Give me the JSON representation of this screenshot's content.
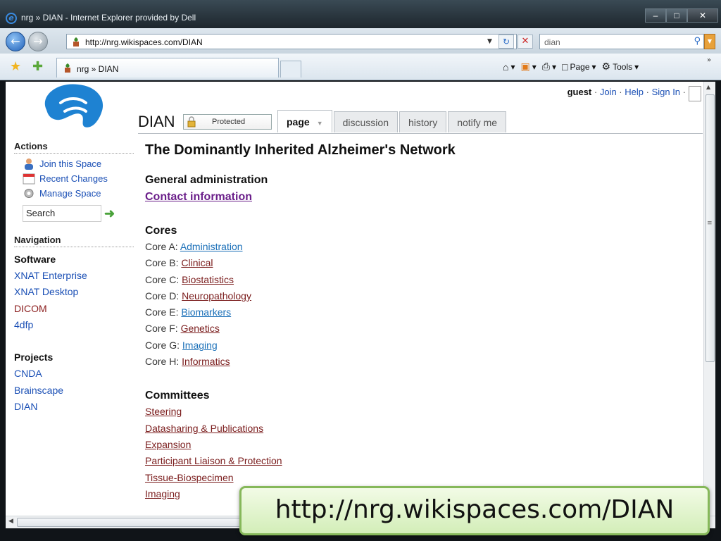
{
  "window": {
    "title": "nrg » DIAN - Internet Explorer provided by Dell",
    "min": "–",
    "max": "□",
    "close": "✕"
  },
  "browser": {
    "url": "http://nrg.wikispaces.com/DIAN",
    "search_value": "dian",
    "tab_title": "nrg » DIAN",
    "commands": {
      "page": "Page",
      "tools": "Tools"
    }
  },
  "wiki": {
    "user": {
      "name": "guest",
      "join": "Join",
      "help": "Help",
      "signin": "Sign In"
    },
    "space_title": "DIAN",
    "protected_label": "Protected",
    "tabs": [
      "page",
      "discussion",
      "history",
      "notify me"
    ],
    "sidebar": {
      "actions_heading": "Actions",
      "actions": [
        "Join this Space",
        "Recent Changes",
        "Manage Space"
      ],
      "search_value": "Search",
      "navigation_heading": "Navigation",
      "software_heading": "Software",
      "software": [
        "XNAT Enterprise",
        "XNAT Desktop",
        "DICOM",
        "4dfp"
      ],
      "projects_heading": "Projects",
      "projects": [
        "CNDA",
        "Brainscape",
        "DIAN"
      ]
    },
    "main": {
      "title": "The Dominantly Inherited Alzheimer's Network",
      "general_heading": "General administration",
      "contact_link": "Contact information",
      "cores_heading": "Cores",
      "cores": [
        {
          "prefix": "Core A: ",
          "link": "Administration"
        },
        {
          "prefix": "Core B: ",
          "link": "Clinical"
        },
        {
          "prefix": "Core C: ",
          "link": "Biostatistics"
        },
        {
          "prefix": "Core D: ",
          "link": "Neuropathology"
        },
        {
          "prefix": "Core E: ",
          "link": "Biomarkers"
        },
        {
          "prefix": "Core F: ",
          "link": "Genetics"
        },
        {
          "prefix": "Core G: ",
          "link": "Imaging"
        },
        {
          "prefix": "Core H: ",
          "link": "Informatics"
        }
      ],
      "committees_heading": "Committees",
      "committees": [
        "Steering",
        "Datasharing & Publications",
        "Expansion",
        "Participant Liaison & Protection",
        "Tissue-Biospecimen",
        "Imaging"
      ]
    }
  },
  "caption": "http://nrg.wikispaces.com/DIAN",
  "colors": {
    "link_blue": "#1a6fb8",
    "link_red": "#7a1c1c",
    "caption_border": "#86b85a",
    "logo_blue": "#1e82d2"
  }
}
